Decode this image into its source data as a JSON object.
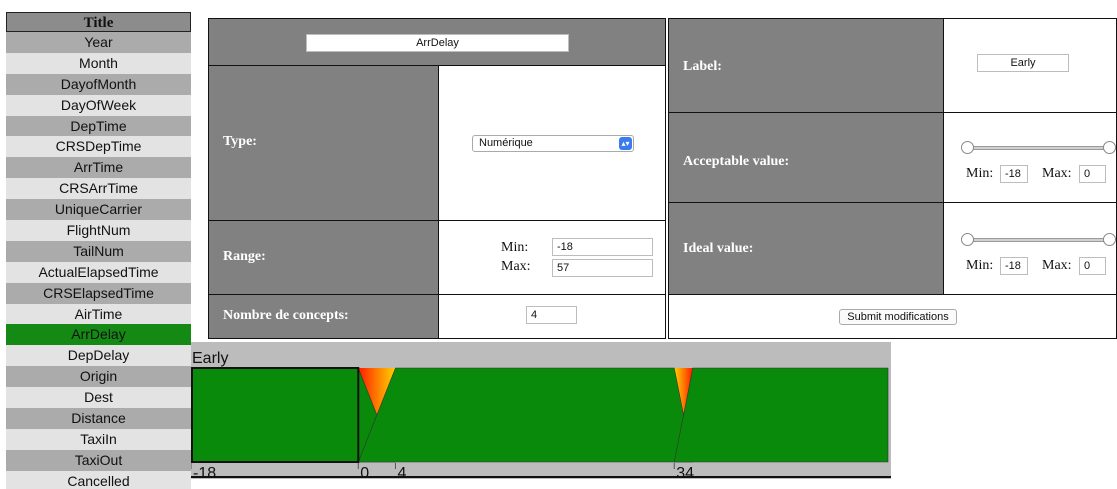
{
  "sidebar": {
    "title": "Title",
    "items": [
      "Year",
      "Month",
      "DayofMonth",
      "DayOfWeek",
      "DepTime",
      "CRSDepTime",
      "ArrTime",
      "CRSArrTime",
      "UniqueCarrier",
      "FlightNum",
      "TailNum",
      "ActualElapsedTime",
      "CRSElapsedTime",
      "AirTime",
      "ArrDelay",
      "DepDelay",
      "Origin",
      "Dest",
      "Distance",
      "TaxiIn",
      "TaxiOut",
      "Cancelled"
    ],
    "active": "ArrDelay"
  },
  "variable_panel": {
    "name_value": "ArrDelay",
    "type_label": "Type:",
    "type_value": "Numérique",
    "range_label": "Range:",
    "min_label": "Min:",
    "min_value": "-18",
    "max_label": "Max:",
    "max_value": "57",
    "concepts_label": "Nombre de concepts:",
    "concepts_value": "4"
  },
  "concept_panel": {
    "label_label": "Label:",
    "label_value": "Early",
    "acceptable_label": "Acceptable value:",
    "acceptable_min_label": "Min:",
    "acceptable_min_value": "-18",
    "acceptable_max_label": "Max:",
    "acceptable_max_value": "0",
    "ideal_label": "Ideal value:",
    "ideal_min_label": "Min:",
    "ideal_min_value": "-18",
    "ideal_max_label": "Max:",
    "ideal_max_value": "0",
    "submit_label": "Submit modifications"
  },
  "colors": {
    "green": "#0a8a0a",
    "gray": "#bcbcbc",
    "active": "#148a14",
    "panel_dark": "#818181"
  },
  "chart_data": {
    "type": "area",
    "title": "Early",
    "domain": [
      -18,
      57
    ],
    "ticks": [
      {
        "value": -18,
        "label": "-18"
      },
      {
        "value": 0,
        "label": "0"
      },
      {
        "value": 4,
        "label": "4"
      },
      {
        "value": 34,
        "label": "34"
      }
    ],
    "concepts": [
      {
        "start": -18,
        "end": 0
      },
      {
        "start": 4,
        "end": 34
      },
      {
        "start": 36,
        "end": 57
      }
    ],
    "transitions": [
      {
        "from": 0,
        "to": 4
      },
      {
        "from": 34,
        "to": 36
      }
    ],
    "selected": {
      "start": -18,
      "end": 0
    }
  }
}
